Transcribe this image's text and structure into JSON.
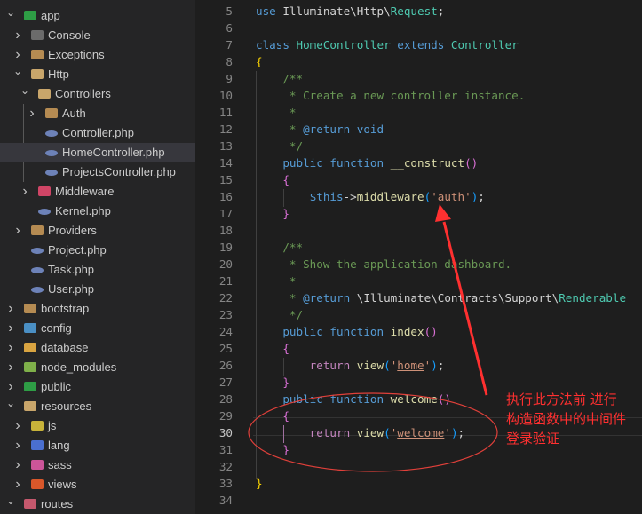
{
  "explorer": {
    "items": [
      {
        "label": "app",
        "level": 0,
        "type": "folder",
        "open": true,
        "color": "#2e9d45"
      },
      {
        "label": "Console",
        "level": 1,
        "type": "folder",
        "open": false,
        "color": "#6b6b6b"
      },
      {
        "label": "Exceptions",
        "level": 1,
        "type": "folder",
        "open": false,
        "color": "#b58b52"
      },
      {
        "label": "Http",
        "level": 1,
        "type": "folder",
        "open": true,
        "color": "#c9a66b"
      },
      {
        "label": "Controllers",
        "level": 2,
        "type": "folder",
        "open": true,
        "color": "#c9a66b"
      },
      {
        "label": "Auth",
        "level": 3,
        "type": "folder",
        "open": false,
        "color": "#b58b52"
      },
      {
        "label": "Controller.php",
        "level": 3,
        "type": "php"
      },
      {
        "label": "HomeController.php",
        "level": 3,
        "type": "php",
        "selected": true
      },
      {
        "label": "ProjectsController.php",
        "level": 3,
        "type": "php"
      },
      {
        "label": "Middleware",
        "level": 2,
        "type": "folder",
        "open": false,
        "color": "#d04566"
      },
      {
        "label": "Kernel.php",
        "level": 2,
        "type": "php"
      },
      {
        "label": "Providers",
        "level": 1,
        "type": "folder",
        "open": false,
        "color": "#b58b52"
      },
      {
        "label": "Project.php",
        "level": 1,
        "type": "php"
      },
      {
        "label": "Task.php",
        "level": 1,
        "type": "php"
      },
      {
        "label": "User.php",
        "level": 1,
        "type": "php"
      },
      {
        "label": "bootstrap",
        "level": 0,
        "type": "folder",
        "open": false,
        "color": "#b58b52"
      },
      {
        "label": "config",
        "level": 0,
        "type": "folder",
        "open": false,
        "color": "#4a8fc4"
      },
      {
        "label": "database",
        "level": 0,
        "type": "folder",
        "open": false,
        "color": "#d9a441"
      },
      {
        "label": "node_modules",
        "level": 0,
        "type": "folder",
        "open": false,
        "color": "#7fb04a"
      },
      {
        "label": "public",
        "level": 0,
        "type": "folder",
        "open": false,
        "color": "#2e9d45"
      },
      {
        "label": "resources",
        "level": 0,
        "type": "folder",
        "open": true,
        "color": "#c9a66b"
      },
      {
        "label": "js",
        "level": 1,
        "type": "folder",
        "open": false,
        "color": "#c8b33a"
      },
      {
        "label": "lang",
        "level": 1,
        "type": "folder",
        "open": false,
        "color": "#4a6fd0"
      },
      {
        "label": "sass",
        "level": 1,
        "type": "folder",
        "open": false,
        "color": "#cc5599"
      },
      {
        "label": "views",
        "level": 1,
        "type": "folder",
        "open": false,
        "color": "#d8572a"
      },
      {
        "label": "routes",
        "level": 0,
        "type": "folder",
        "open": true,
        "color": "#c5586d"
      }
    ]
  },
  "editor": {
    "current_line": 30,
    "lines": [
      {
        "n": 5,
        "t": [
          [
            "use ",
            "kw"
          ],
          [
            "Illuminate\\Http\\",
            "tx"
          ],
          [
            "Request",
            "cls"
          ],
          [
            ";",
            "tx"
          ]
        ]
      },
      {
        "n": 6,
        "t": []
      },
      {
        "n": 7,
        "t": [
          [
            "class ",
            "kw"
          ],
          [
            "HomeController ",
            "cls"
          ],
          [
            "extends ",
            "kw"
          ],
          [
            "Controller",
            "cls"
          ]
        ]
      },
      {
        "n": 8,
        "t": [
          [
            "{",
            "b1"
          ]
        ]
      },
      {
        "n": 9,
        "t": [
          [
            "    /**",
            "cm"
          ]
        ]
      },
      {
        "n": 10,
        "t": [
          [
            "     * Create a new controller instance.",
            "cm"
          ]
        ]
      },
      {
        "n": 11,
        "t": [
          [
            "     *",
            "cm"
          ]
        ]
      },
      {
        "n": 12,
        "t": [
          [
            "     * ",
            "cm"
          ],
          [
            "@return void",
            "kw"
          ]
        ]
      },
      {
        "n": 13,
        "t": [
          [
            "     */",
            "cm"
          ]
        ]
      },
      {
        "n": 14,
        "t": [
          [
            "    public function ",
            "kw"
          ],
          [
            "__construct",
            "fn"
          ],
          [
            "()",
            "b2"
          ]
        ]
      },
      {
        "n": 15,
        "t": [
          [
            "    ",
            "tx"
          ],
          [
            "{",
            "b2"
          ]
        ]
      },
      {
        "n": 16,
        "t": [
          [
            "        ",
            "tx"
          ],
          [
            "$this",
            "kw"
          ],
          [
            "->",
            "tx"
          ],
          [
            "middleware",
            "fn"
          ],
          [
            "(",
            "b3"
          ],
          [
            "'auth'",
            "str"
          ],
          [
            ")",
            "b3"
          ],
          [
            ";",
            "tx"
          ]
        ]
      },
      {
        "n": 17,
        "t": [
          [
            "    ",
            "tx"
          ],
          [
            "}",
            "b2"
          ]
        ]
      },
      {
        "n": 18,
        "t": []
      },
      {
        "n": 19,
        "t": [
          [
            "    /**",
            "cm"
          ]
        ]
      },
      {
        "n": 20,
        "t": [
          [
            "     * Show the application dashboard.",
            "cm"
          ]
        ]
      },
      {
        "n": 21,
        "t": [
          [
            "     *",
            "cm"
          ]
        ]
      },
      {
        "n": 22,
        "t": [
          [
            "     * ",
            "cm"
          ],
          [
            "@return ",
            "kw"
          ],
          [
            "\\Illuminate\\Contracts\\Support\\",
            "tx"
          ],
          [
            "Renderable",
            "cls"
          ]
        ]
      },
      {
        "n": 23,
        "t": [
          [
            "     */",
            "cm"
          ]
        ]
      },
      {
        "n": 24,
        "t": [
          [
            "    public function ",
            "kw"
          ],
          [
            "index",
            "fn"
          ],
          [
            "()",
            "b2"
          ]
        ]
      },
      {
        "n": 25,
        "t": [
          [
            "    ",
            "tx"
          ],
          [
            "{",
            "b2"
          ]
        ]
      },
      {
        "n": 26,
        "t": [
          [
            "        ",
            "tx"
          ],
          [
            "return ",
            "ctl"
          ],
          [
            "view",
            "fn"
          ],
          [
            "(",
            "b3"
          ],
          [
            "'",
            "str"
          ],
          [
            "home",
            "str ul"
          ],
          [
            "'",
            "str"
          ],
          [
            ")",
            "b3"
          ],
          [
            ";",
            "tx"
          ]
        ]
      },
      {
        "n": 27,
        "t": [
          [
            "    ",
            "tx"
          ],
          [
            "}",
            "b2"
          ]
        ]
      },
      {
        "n": 28,
        "t": [
          [
            "    public function ",
            "kw"
          ],
          [
            "welcome",
            "fn"
          ],
          [
            "()",
            "b2"
          ]
        ]
      },
      {
        "n": 29,
        "t": [
          [
            "    ",
            "tx"
          ],
          [
            "{",
            "b2"
          ]
        ]
      },
      {
        "n": 30,
        "t": [
          [
            "        ",
            "tx"
          ],
          [
            "return ",
            "ctl"
          ],
          [
            "view",
            "fn"
          ],
          [
            "(",
            "b3"
          ],
          [
            "'",
            "str"
          ],
          [
            "welcome",
            "str ul"
          ],
          [
            "'",
            "str"
          ],
          [
            ")",
            "b3"
          ],
          [
            ";",
            "tx"
          ]
        ]
      },
      {
        "n": 31,
        "t": [
          [
            "    ",
            "tx"
          ],
          [
            "}",
            "b2"
          ]
        ]
      },
      {
        "n": 32,
        "t": []
      },
      {
        "n": 33,
        "t": [
          [
            "}",
            "b1"
          ]
        ]
      },
      {
        "n": 34,
        "t": []
      }
    ]
  },
  "annotation": {
    "color": "#ff3030",
    "note_lines": [
      "执行此方法前 进行",
      "构造函数中的中间件",
      "登录验证"
    ]
  }
}
